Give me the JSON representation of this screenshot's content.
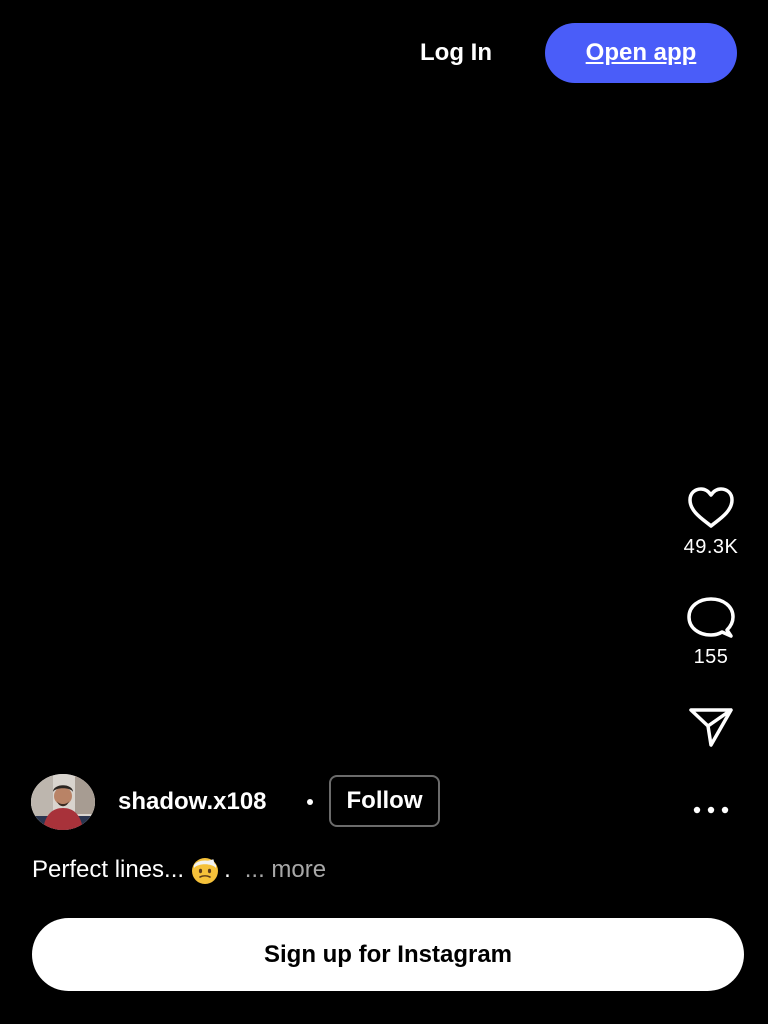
{
  "topbar": {
    "login_label": "Log In",
    "open_app_label": "Open app",
    "open_app_color": "#4a5df9"
  },
  "actions": {
    "like": {
      "icon": "heart-icon",
      "count": "49.3K"
    },
    "comment": {
      "icon": "comment-icon",
      "count": "155"
    },
    "share": {
      "icon": "send-icon"
    },
    "more": {
      "icon": "more-horizontal-icon"
    }
  },
  "post": {
    "username": "shadow.x108",
    "separator": "•",
    "follow_label": "Follow",
    "caption_text": "Perfect lines...",
    "caption_emoji": "face-with-head-bandage-emoji",
    "caption_suffix": ".",
    "caption_more": "... more"
  },
  "footer": {
    "signup_label": "Sign up for Instagram"
  }
}
